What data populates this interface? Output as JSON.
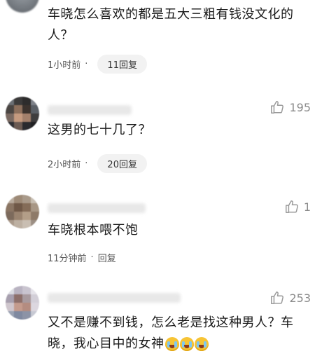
{
  "comments": [
    {
      "text": "车晓怎么喜欢的都是五大三粗有钱没文化的人？",
      "time": "1小时前",
      "separator": "·",
      "reply": "11回复"
    },
    {
      "likes": "195",
      "text": "这男的七十几了？",
      "time": "2小时前",
      "separator": "·",
      "reply": "20回复"
    },
    {
      "likes": "1",
      "text": "车晓根本喂不饱",
      "time": "11分钟前",
      "separator": "·",
      "reply": "回复"
    },
    {
      "likes": "253",
      "text": "又不是赚不到钱，怎么老是找这种男人？车晓，我心目中的女神",
      "emoji": "loudly-crying-face",
      "emoji_count": 3
    }
  ],
  "colors": {
    "text": "#1a1a1a",
    "meta": "#555555",
    "like": "#8a8a8a",
    "pill_bg": "#f2f2f2"
  }
}
